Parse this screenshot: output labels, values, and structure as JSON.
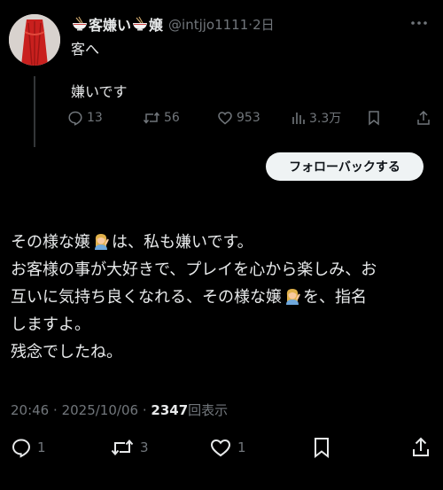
{
  "quoted_post": {
    "display_name_part1": "客嫌い",
    "display_name_part2": "嬢",
    "handle": "@intjjo1111",
    "separator": "·",
    "time_ago": "2日",
    "line1": "客へ",
    "line2": "嫌いです",
    "replies": "13",
    "reposts": "56",
    "likes": "953",
    "views": "3.3万"
  },
  "follow_back_label": "フォローバックする",
  "main_post": {
    "line1_before": "その様な嬢",
    "line1_after": "は、私も嫌いです。",
    "line2": "お客様の事が大好きで、プレイを心から楽しみ、お",
    "line3_before": "互いに気持ち良くなれる、その様な嬢",
    "line3_after": "を、指名",
    "line4": "しますよ。",
    "line5": "残念でしたね。",
    "time": "20:46",
    "date": "2025/10/06",
    "dot": "·",
    "views_count": "2347",
    "views_label": "回表示",
    "replies": "1",
    "reposts": "3",
    "likes": "1"
  },
  "icons": {
    "bowl": "ramen-bowl-icon",
    "woman": "woman-raising-hand-emoji",
    "more": "more-icon"
  },
  "colors": {
    "background": "#000000",
    "text": "#e7e9ea",
    "muted": "#71767b",
    "button_bg": "#eff3f4",
    "button_text": "#0f1419"
  }
}
